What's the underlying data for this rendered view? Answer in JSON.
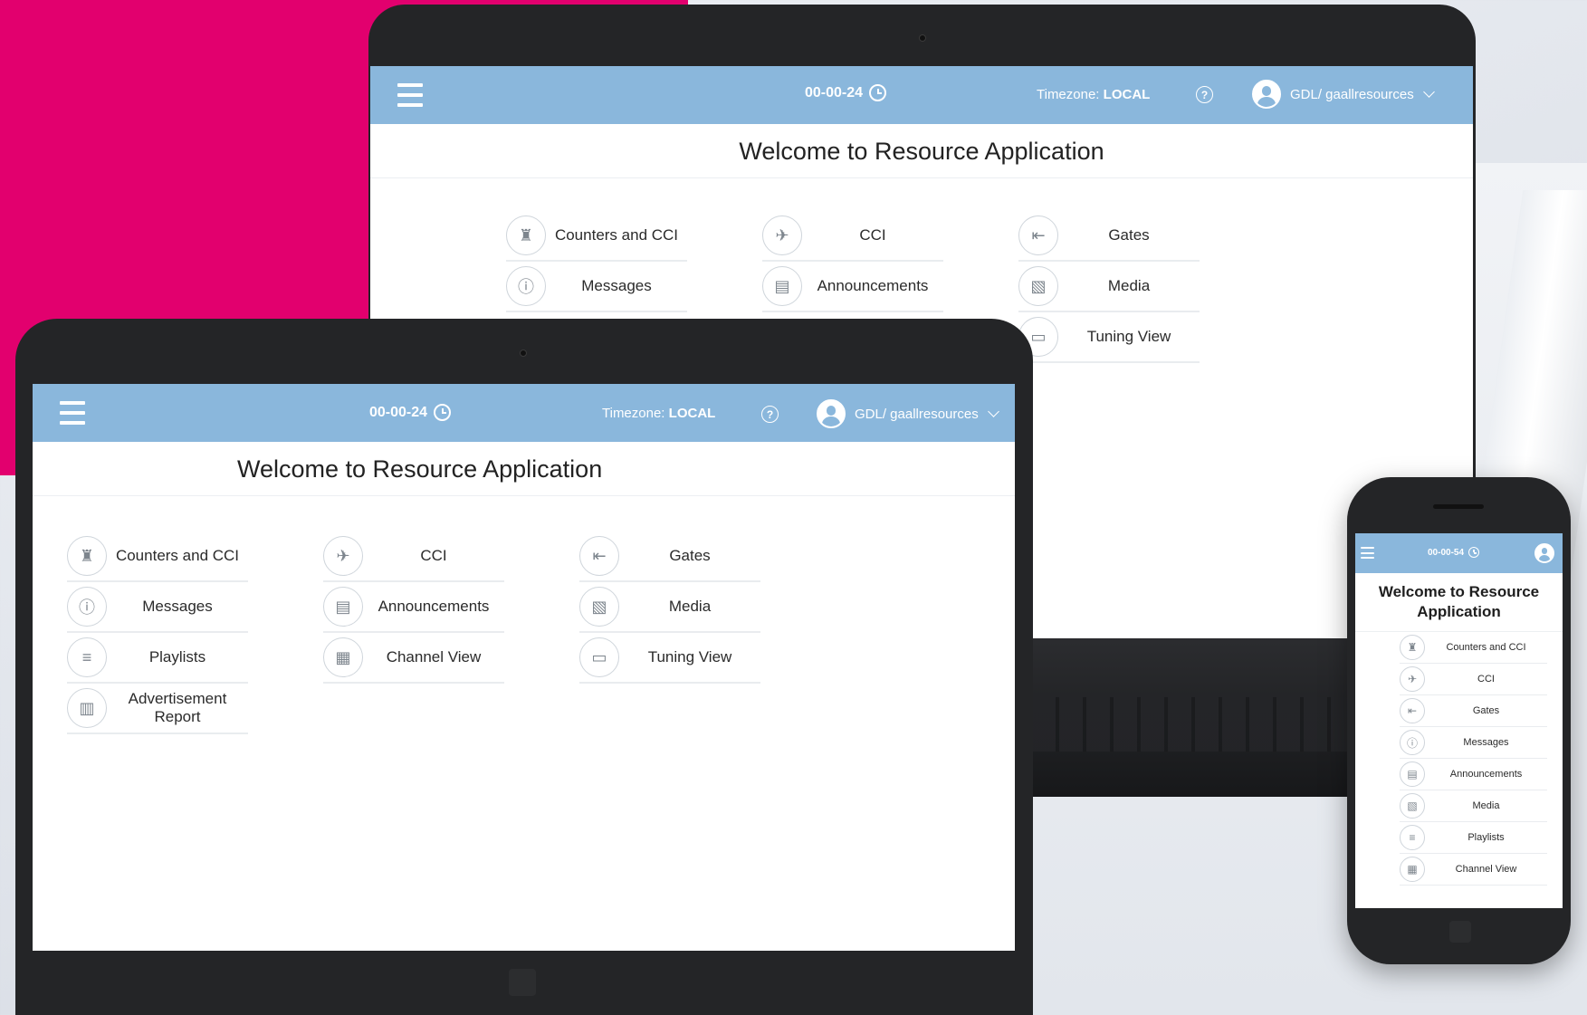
{
  "app": {
    "title": "Welcome to Resource Application",
    "timezone_label": "Timezone:",
    "timezone_value": "LOCAL",
    "help_glyph": "?",
    "user": "GDL/ gaallresources"
  },
  "laptop": {
    "clock": "00-00-24",
    "tiles": [
      {
        "label": "Counters and CCI",
        "icon": "counter-person-icon",
        "glyph": "♜"
      },
      {
        "label": "CCI",
        "icon": "plane-luggage-icon",
        "glyph": "✈"
      },
      {
        "label": "Gates",
        "icon": "gate-arrow-icon",
        "glyph": "⇤"
      },
      {
        "label": "Messages",
        "icon": "info-icon",
        "glyph": "ⓘ"
      },
      {
        "label": "Announcements",
        "icon": "announcement-board-icon",
        "glyph": "▤"
      },
      {
        "label": "Media",
        "icon": "image-media-icon",
        "glyph": "▧"
      },
      {
        "label": "",
        "icon": "",
        "glyph": ""
      },
      {
        "label": "",
        "icon": "",
        "glyph": ""
      },
      {
        "label": "Tuning View",
        "icon": "monitor-check-icon",
        "glyph": "▭"
      }
    ]
  },
  "tablet": {
    "clock": "00-00-24",
    "tiles": [
      {
        "label": "Counters and CCI",
        "icon": "counter-person-icon",
        "glyph": "♜"
      },
      {
        "label": "CCI",
        "icon": "plane-luggage-icon",
        "glyph": "✈"
      },
      {
        "label": "Gates",
        "icon": "gate-arrow-icon",
        "glyph": "⇤"
      },
      {
        "label": "Messages",
        "icon": "info-icon",
        "glyph": "ⓘ"
      },
      {
        "label": "Announcements",
        "icon": "announcement-board-icon",
        "glyph": "▤"
      },
      {
        "label": "Media",
        "icon": "image-media-icon",
        "glyph": "▧"
      },
      {
        "label": "Playlists",
        "icon": "playlist-icon",
        "glyph": "≡"
      },
      {
        "label": "Channel View",
        "icon": "film-grid-icon",
        "glyph": "▦"
      },
      {
        "label": "Tuning View",
        "icon": "monitor-check-icon",
        "glyph": "▭"
      },
      {
        "label": "Advertisement Report",
        "icon": "report-chart-icon",
        "glyph": "▥"
      }
    ]
  },
  "phone": {
    "clock": "00-00-54",
    "tiles": [
      {
        "label": "Counters and CCI",
        "icon": "counter-person-icon",
        "glyph": "♜"
      },
      {
        "label": "CCI",
        "icon": "plane-luggage-icon",
        "glyph": "✈"
      },
      {
        "label": "Gates",
        "icon": "gate-arrow-icon",
        "glyph": "⇤"
      },
      {
        "label": "Messages",
        "icon": "info-icon",
        "glyph": "ⓘ"
      },
      {
        "label": "Announcements",
        "icon": "announcement-board-icon",
        "glyph": "▤"
      },
      {
        "label": "Media",
        "icon": "image-media-icon",
        "glyph": "▧"
      },
      {
        "label": "Playlists",
        "icon": "playlist-icon",
        "glyph": "≡"
      },
      {
        "label": "Channel View",
        "icon": "film-grid-icon",
        "glyph": "▦"
      }
    ]
  },
  "colors": {
    "header": "#8ab7dc",
    "brand_pink": "#e2006e",
    "device_frame": "#242527"
  }
}
